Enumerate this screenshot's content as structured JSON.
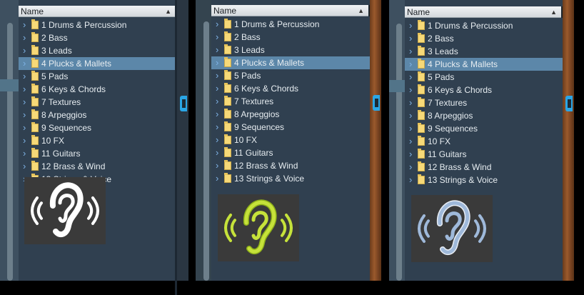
{
  "browser": {
    "column_header": "Name",
    "sort_indicator": "▲",
    "items": [
      "1 Drums & Percussion",
      "2 Bass",
      "3 Leads",
      "4 Plucks & Mallets",
      "5 Pads",
      "6 Keys & Chords",
      "7 Textures",
      "8 Arpeggios",
      "9 Sequences",
      "10 FX",
      "11 Guitars",
      "12 Brass & Wind",
      "13 Strings & Voice"
    ],
    "selected_item": "4 Plucks & Mallets"
  },
  "variants": [
    {
      "ear_color": "#ffffff",
      "ear_outline": "#ffffff"
    },
    {
      "ear_color": "#c6e23a",
      "ear_outline": "#8fb11a"
    },
    {
      "ear_color": "#9fb9da",
      "ear_outline": "#e9eef5"
    }
  ],
  "colors": {
    "panel_bg": "#304050",
    "selection": "#5c87a9",
    "folder": "#f6d978",
    "chevron": "#7fb3e6"
  }
}
